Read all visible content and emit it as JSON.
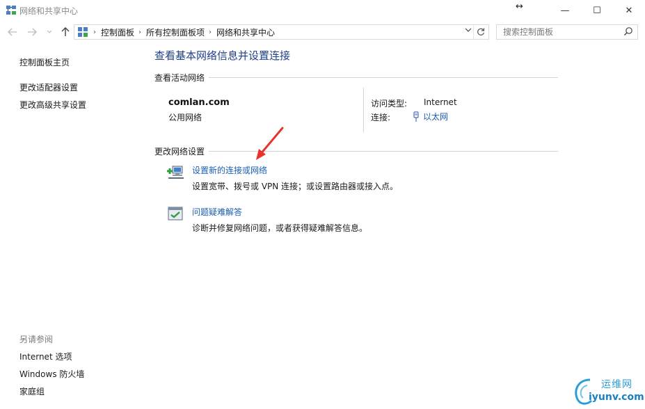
{
  "window": {
    "title": "网络和共享中心",
    "controls": {
      "minimize": "—",
      "maximize": "☐",
      "close": "✕"
    }
  },
  "navigation": {
    "breadcrumb": [
      "控制面板",
      "所有控制面板项",
      "网络和共享中心"
    ],
    "search_placeholder": "搜索控制面板"
  },
  "sidebar": {
    "links": [
      "控制面板主页",
      "更改适配器设置",
      "更改高级共享设置"
    ],
    "see_also_label": "另请参阅",
    "see_also_links": [
      "Internet 选项",
      "Windows 防火墙",
      "家庭组"
    ]
  },
  "main": {
    "title": "查看基本网络信息并设置连接",
    "active_networks": {
      "heading": "查看活动网络",
      "network_name": "comlan.com",
      "network_type": "公用网络",
      "access_type_label": "访问类型:",
      "access_type_value": "Internet",
      "connections_label": "连接:",
      "connection_name": "以太网"
    },
    "change_settings": {
      "heading": "更改网络设置",
      "tasks": [
        {
          "link": "设置新的连接或网络",
          "description": "设置宽带、拨号或 VPN 连接；或设置路由器或接入点。",
          "icon": "new-connection-icon"
        },
        {
          "link": "问题疑难解答",
          "description": "诊断并修复网络问题，或者获得疑难解答信息。",
          "icon": "troubleshoot-icon"
        }
      ]
    }
  },
  "watermark": {
    "line1": "运维网",
    "line2": "iyunv.com"
  },
  "colors": {
    "link": "#1a5fb4",
    "title": "#1e3f8a",
    "annotation_arrow": "#e8332a"
  }
}
